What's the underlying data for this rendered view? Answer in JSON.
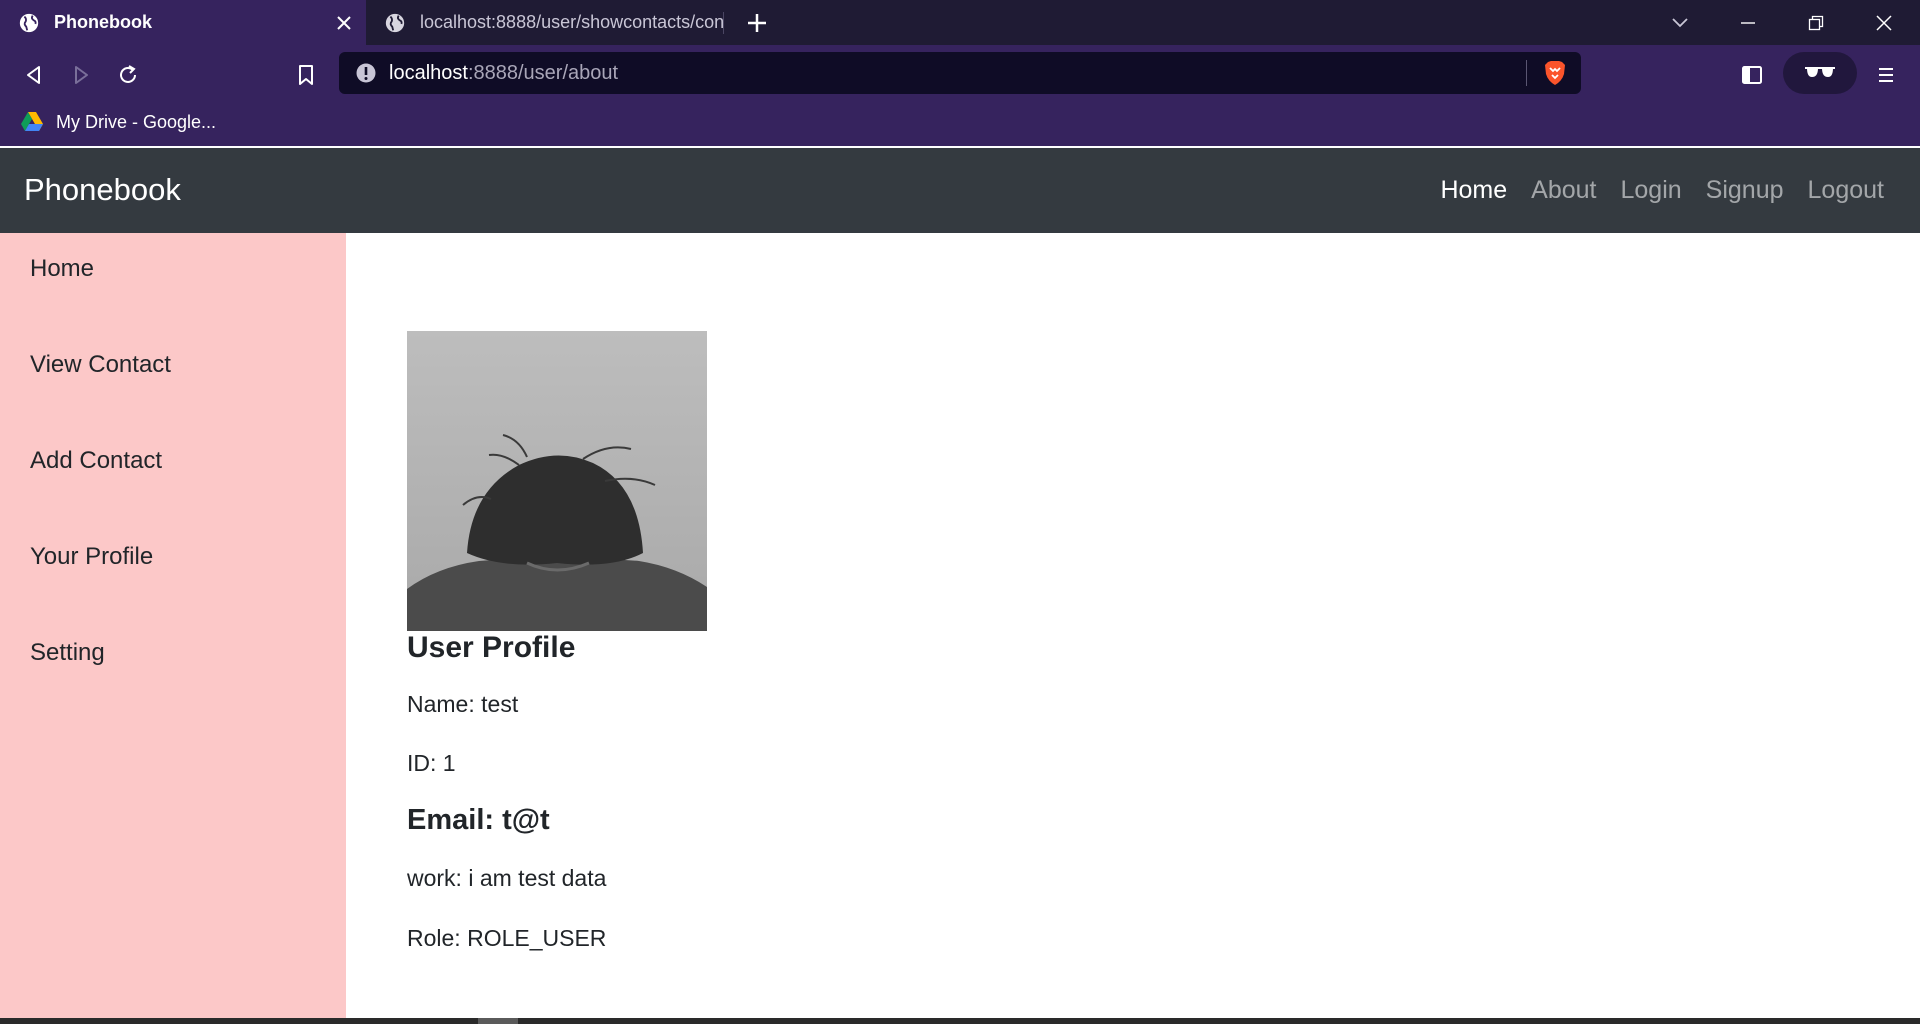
{
  "browser": {
    "tabs": [
      {
        "title": "Phonebook",
        "favicon": "globe-icon",
        "active": true
      },
      {
        "title": "localhost:8888/user/showcontacts/con",
        "favicon": "globe-icon",
        "active": false
      }
    ],
    "address": {
      "host": "localhost",
      "path": ":8888/user/about"
    },
    "bookmarks": [
      {
        "label": "My Drive - Google...",
        "icon": "google-drive-icon"
      }
    ],
    "colors": {
      "tab_strip": "#1f1b34",
      "toolbar": "#36235e",
      "omnibox": "#0f0c26"
    }
  },
  "site": {
    "brand": "Phonebook",
    "nav": {
      "home": "Home",
      "about": "About",
      "login": "Login",
      "signup": "Signup",
      "logout": "Logout"
    },
    "colors": {
      "navbar": "#343a40",
      "sidebar": "#fcc8c8"
    }
  },
  "sidebar": {
    "items": [
      "Home",
      "View Contact",
      "Add Contact",
      "Your Profile",
      "Setting"
    ]
  },
  "profile": {
    "heading": "User Profile",
    "name": "Name: test",
    "id": "ID: 1",
    "email": "Email: t@t",
    "work": "work: i am test data",
    "role": "Role: ROLE_USER"
  }
}
